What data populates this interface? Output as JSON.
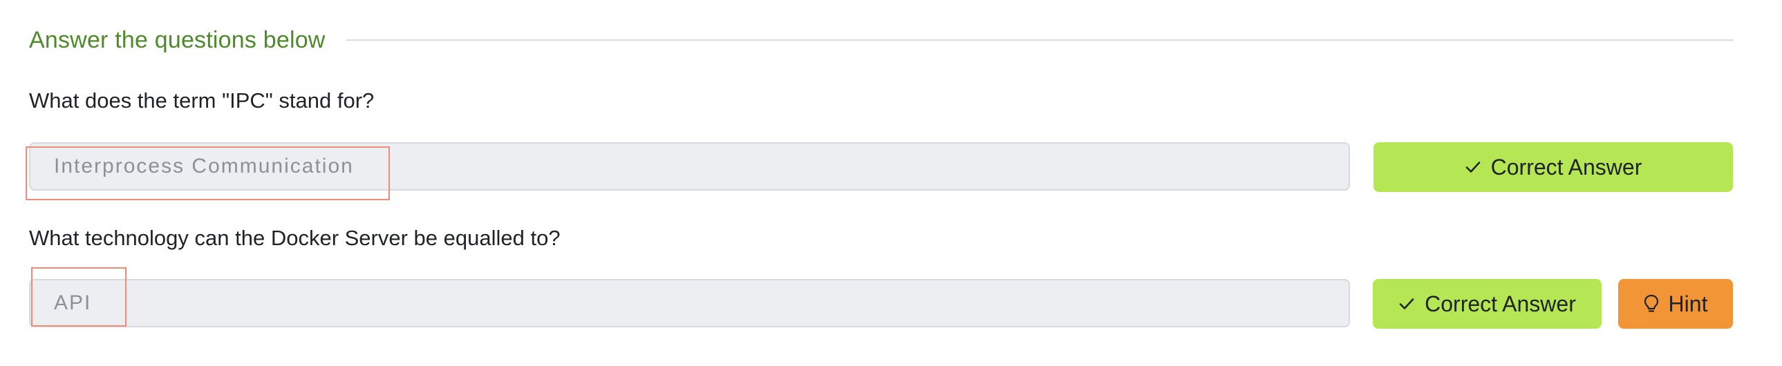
{
  "section": {
    "title": "Answer the questions below"
  },
  "questions": [
    {
      "text": "What does the term \"IPC\" stand for?",
      "answer": "Interprocess Communication",
      "correct_label": "Correct Answer"
    },
    {
      "text": "What technology can the Docker Server be equalled to?",
      "answer": "API",
      "correct_label": "Correct Answer",
      "hint_label": "Hint"
    }
  ],
  "icons": {
    "correct": "checkmark-icon",
    "hint": "lightbulb-icon"
  },
  "colors": {
    "title": "#4f8a2a",
    "correct_button": "#b5e653",
    "hint_button": "#f29536",
    "highlight": "#f18a78"
  }
}
